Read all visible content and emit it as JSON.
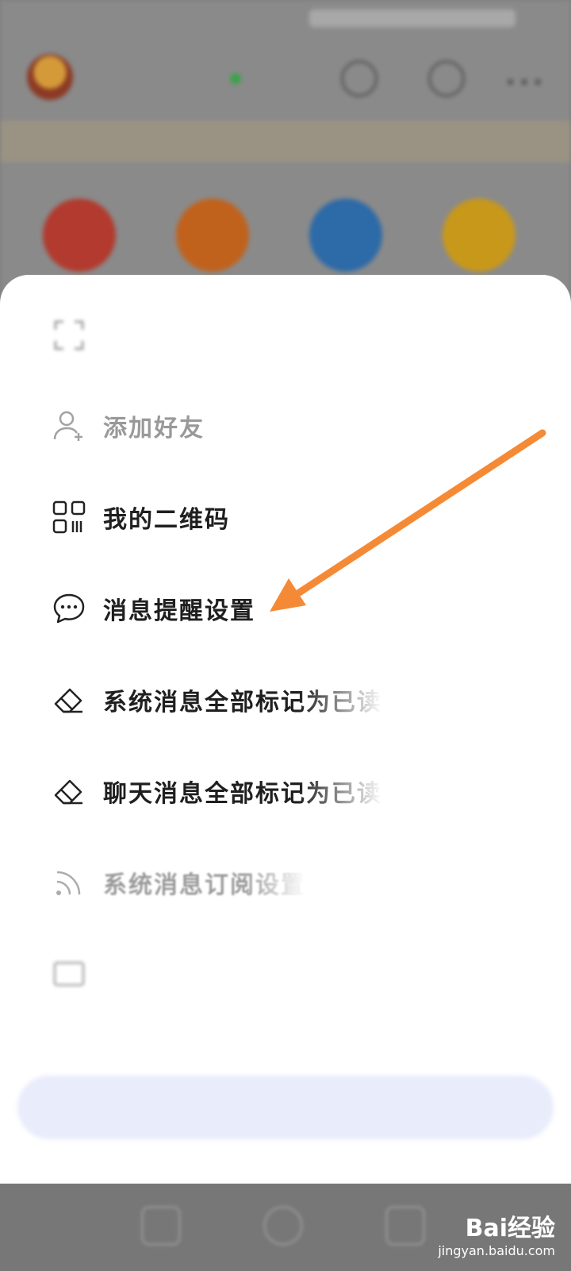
{
  "background_app": {
    "status_time": "",
    "title": "",
    "online_text": "",
    "notice_text": "",
    "notice_link": "",
    "quick_icon_colors": [
      "#b23a2e",
      "#c0621c",
      "#2d6aa8",
      "#c8981a"
    ]
  },
  "menu": {
    "items": [
      {
        "label": "",
        "icon": "scan-icon",
        "state": "blurred"
      },
      {
        "label": "添加好友",
        "icon": "add-friend-icon",
        "state": "dim"
      },
      {
        "label": "我的二维码",
        "icon": "qr-code-icon",
        "state": "normal"
      },
      {
        "label": "消息提醒设置",
        "icon": "chat-bubble-icon",
        "state": "normal"
      },
      {
        "label": "系统消息全部标记为已读",
        "icon": "eraser-icon",
        "state": "normal"
      },
      {
        "label": "聊天消息全部标记为已读",
        "icon": "eraser-icon",
        "state": "normal"
      },
      {
        "label": "系统消息订阅设置",
        "icon": "rss-icon",
        "state": "dim"
      },
      {
        "label": "",
        "icon": "mail-icon",
        "state": "blurred"
      }
    ],
    "close_label": ""
  },
  "annotation": {
    "color": "#f58a36",
    "target": "消息提醒设置"
  },
  "watermark": {
    "brand": "Bai经验",
    "url": "jingyan.baidu.com"
  },
  "colors": {
    "sheet": "#ffffff",
    "overlay": "#7d7d7d",
    "close_button": "#e8ecfb"
  }
}
